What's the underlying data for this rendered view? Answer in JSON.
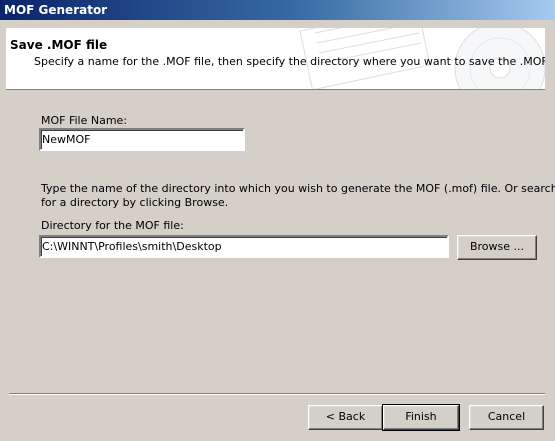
{
  "window": {
    "title": "MOF Generator"
  },
  "banner": {
    "title": "Save .MOF file",
    "description": "Specify a name for the .MOF file, then specify the directory where you want to save the .MOF file.",
    "art_icon": "cd-disc-icon"
  },
  "form": {
    "file_name_label": "MOF File Name:",
    "file_name_value": "NewMOF",
    "instructions_line1": "Type the name of the directory into which you wish to generate the MOF (.mof) file.  Or search",
    "instructions_line2": "for a directory by clicking Browse.",
    "directory_label": "Directory for the MOF file:",
    "directory_value": "C:\\WINNT\\Profiles\\smith\\Desktop",
    "browse_label": "Browse ..."
  },
  "footer": {
    "back_label": "< Back",
    "finish_label": "Finish",
    "cancel_label": "Cancel"
  }
}
